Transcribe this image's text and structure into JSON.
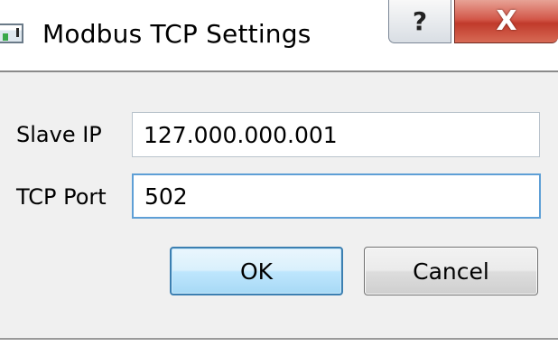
{
  "window": {
    "title": "Modbus TCP Settings",
    "app_icon": "window-app-icon",
    "help_glyph": "?",
    "close_glyph": "X"
  },
  "form": {
    "slave_ip": {
      "label": "Slave IP",
      "value": "127.000.000.001"
    },
    "tcp_port": {
      "label": "TCP Port",
      "value": "502"
    }
  },
  "buttons": {
    "ok_label": "OK",
    "cancel_label": "Cancel"
  },
  "colors": {
    "close_button": "#c03a2b",
    "focus_border": "#5e9fd6",
    "default_button_border": "#3c7fb1"
  }
}
